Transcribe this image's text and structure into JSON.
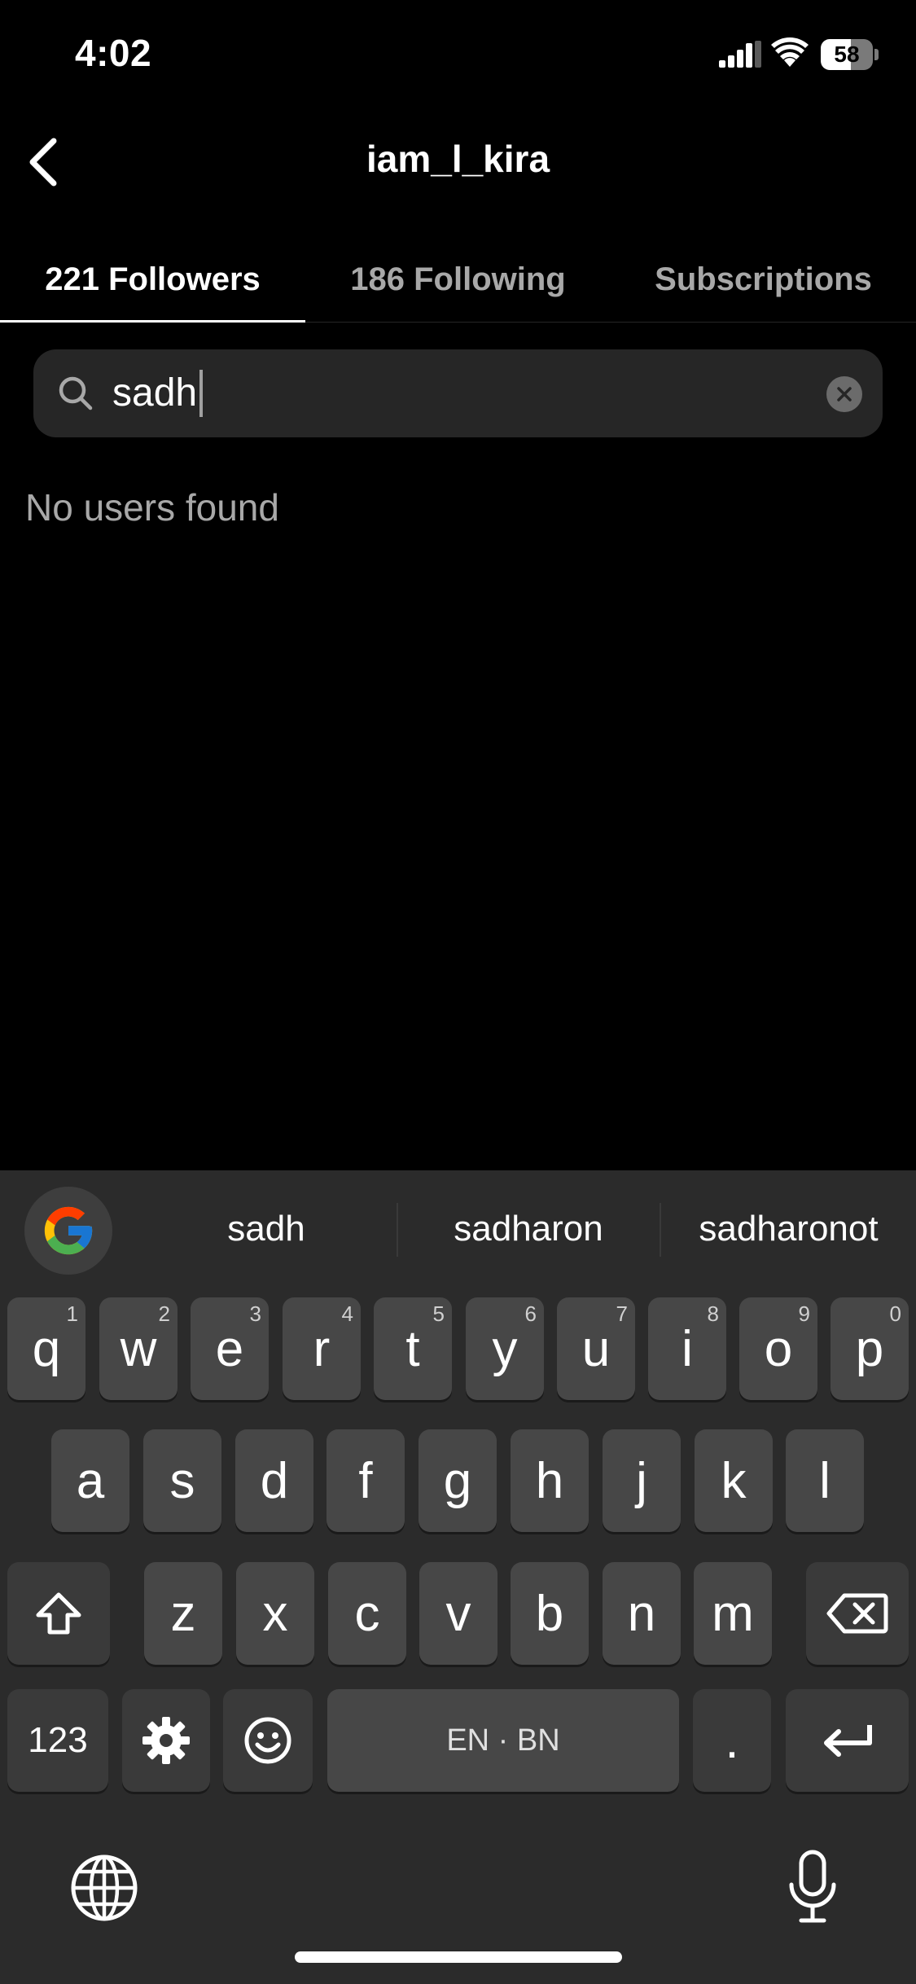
{
  "status_bar": {
    "time": "4:02",
    "battery": "58",
    "battery_level": 0.58
  },
  "header": {
    "title": "iam_l_kira"
  },
  "tabs": [
    {
      "label": "221 Followers",
      "active": true
    },
    {
      "label": "186 Following",
      "active": false
    },
    {
      "label": "Subscriptions",
      "active": false
    }
  ],
  "search": {
    "value": "sadh"
  },
  "results": {
    "empty_message": "No users found"
  },
  "keyboard": {
    "suggestions": [
      "sadh",
      "sadharon",
      "sadharonot"
    ],
    "row1": [
      {
        "key": "q",
        "hint": "1"
      },
      {
        "key": "w",
        "hint": "2"
      },
      {
        "key": "e",
        "hint": "3"
      },
      {
        "key": "r",
        "hint": "4"
      },
      {
        "key": "t",
        "hint": "5"
      },
      {
        "key": "y",
        "hint": "6"
      },
      {
        "key": "u",
        "hint": "7"
      },
      {
        "key": "i",
        "hint": "8"
      },
      {
        "key": "o",
        "hint": "9"
      },
      {
        "key": "p",
        "hint": "0"
      }
    ],
    "row2": [
      "a",
      "s",
      "d",
      "f",
      "g",
      "h",
      "j",
      "k",
      "l"
    ],
    "row3": [
      "z",
      "x",
      "c",
      "v",
      "b",
      "n",
      "m"
    ],
    "numbers_label": "123",
    "space_label": "EN · BN",
    "period_label": "."
  },
  "colors": {
    "background": "#000000",
    "keyboard": "#2b2b2b",
    "key": "#474747",
    "secondary_text": "#a8a8a8"
  }
}
